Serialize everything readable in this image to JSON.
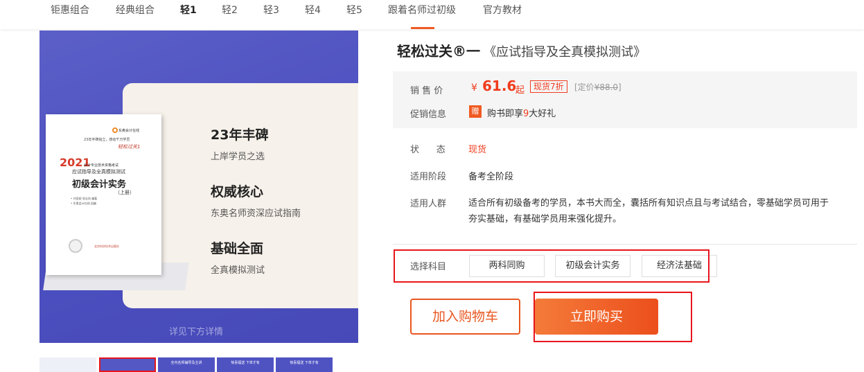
{
  "nav": {
    "items": [
      "钜惠组合",
      "经典组合",
      "轻1",
      "轻2",
      "轻3",
      "轻4",
      "轻5",
      "跟着名师过初级",
      "官方教材"
    ],
    "active_index": 2
  },
  "gallery": {
    "features": [
      {
        "heading": "23年丰碑",
        "sub": "上岸学员之选"
      },
      {
        "heading": "权威核心",
        "sub": "东奥名师资深应试指南"
      },
      {
        "heading": "基础全面",
        "sub": "全真模拟测试"
      }
    ],
    "see_below": "详见下方详情",
    "book": {
      "publisher": "东奥会计在线",
      "slogan": "23年丰碑铭立，感动千万学员",
      "series": "轻松过关1",
      "year": "2021",
      "subtitle1": "会计专业技术资格考试",
      "subtitle2": "应试指导及全真模拟测试",
      "title": "初级会计实务",
      "volume": "（上册）",
      "authors": [
        "• 刘圣妮  张志凤  编著",
        "• 东奥会计在线  组编"
      ],
      "press": "北京科学技术出版社"
    },
    "thumbnails": [
      {
        "label": ""
      },
      {
        "label": ""
      },
      {
        "label": "全内名师辅导及主讲"
      },
      {
        "label": "惊喜福送 下单才有"
      },
      {
        "label": "惊喜福送 下单才有"
      }
    ]
  },
  "product": {
    "title_bold": "轻松过关®一",
    "title_rest": "《应试指导及全真模拟测试》",
    "price_label": "销 售 价",
    "price_symbol": "¥",
    "price": "61.6",
    "price_suffix": "起",
    "discount_badge": "现货7折",
    "original_prefix": "[定价",
    "original_price": "¥88.0",
    "original_suffix": "]",
    "promo_label": "促销信息",
    "gift_badge": "赠",
    "promo_text_before": "购书即享",
    "promo_highlight": "9",
    "promo_text_after": "大好礼",
    "status_label": "状      态",
    "status_value": "现货",
    "stage_label": "适用阶段",
    "stage_value": "备考全阶段",
    "audience_label": "适用人群",
    "audience_value": "适合所有初级备考的学员，本书大而全，囊括所有知识点且与考试结合，零基础学员可用于夯实基础，有基础学员用来强化提升。",
    "subject_label": "选择科目",
    "subjects": [
      "两科同购",
      "初级会计实务",
      "经济法基础"
    ],
    "add_to_cart": "加入购物车",
    "buy_now": "立即购买"
  },
  "colors": {
    "accent": "#f05a22",
    "price_red": "#f03c1e",
    "gallery_blue": "#4c4fbf",
    "highlight_box": "#e8141c"
  }
}
